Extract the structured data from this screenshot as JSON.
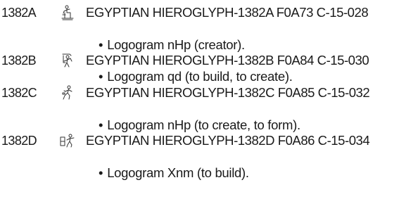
{
  "entries": [
    {
      "code": "1382A",
      "glyph_icon": "hieroglyph-seated-creator-icon",
      "name": "EGYPTIAN HIEROGLYPH-1382A F0A73 C-15-028",
      "bullet": "•",
      "description": "Logogram nHp (creator)."
    },
    {
      "code": "1382B",
      "glyph_icon": "hieroglyph-builder-icon",
      "name": "EGYPTIAN HIEROGLYPH-1382B F0A84 C-15-030",
      "bullet": "•",
      "description": "Logogram qd (to build, to create)."
    },
    {
      "code": "1382C",
      "glyph_icon": "hieroglyph-potter-icon",
      "name": "EGYPTIAN HIEROGLYPH-1382C F0A85 C-15-032",
      "bullet": "•",
      "description": "Logogram nHp (to create, to form)."
    },
    {
      "code": "1382D",
      "glyph_icon": "hieroglyph-potter-wheel-icon",
      "name": "EGYPTIAN HIEROGLYPH-1382D F0A86 C-15-034",
      "bullet": "•",
      "description": "Logogram Xnm (to build)."
    }
  ]
}
